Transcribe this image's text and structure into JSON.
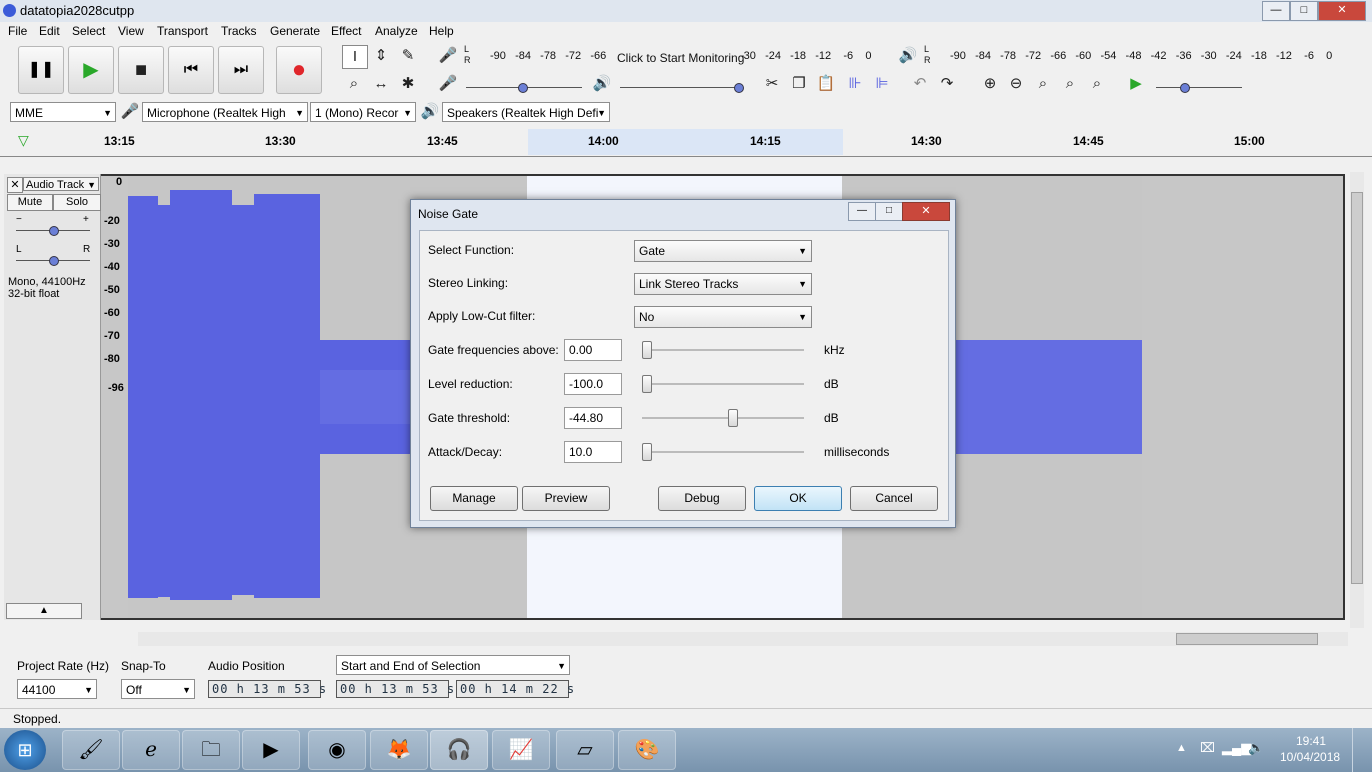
{
  "window": {
    "title": "datatopia2028cutpp",
    "min": "—",
    "max": "□",
    "close": "✕"
  },
  "menu": [
    "File",
    "Edit",
    "Select",
    "View",
    "Transport",
    "Tracks",
    "Generate",
    "Effect",
    "Analyze",
    "Help"
  ],
  "transport": {
    "pause": "❚❚",
    "play": "▶",
    "stop": "■",
    "skip_start": "⏮",
    "skip_end": "⏭",
    "record": "●"
  },
  "meters": {
    "record_scale": [
      "-90",
      "-84",
      "-78",
      "-72",
      "-66"
    ],
    "record_prompt": "Click to Start Monitoring",
    "record_scale_right": [
      "-30",
      "-24",
      "-18",
      "-12",
      "-6",
      "0"
    ],
    "play_scale": [
      "-90",
      "-84",
      "-78",
      "-72",
      "-66",
      "-60",
      "-54",
      "-48",
      "-42",
      "-36",
      "-30",
      "-24",
      "-18",
      "-12",
      "-6",
      "0"
    ],
    "lr": "L\nR"
  },
  "device": {
    "host": "MME",
    "input": "Microphone (Realtek High",
    "channels": "1 (Mono) Recor",
    "output": "Speakers (Realtek High Defi"
  },
  "timeline": {
    "ticks": [
      "13:15",
      "13:30",
      "13:45",
      "14:00",
      "14:15",
      "14:30",
      "14:45",
      "15:00"
    ]
  },
  "track": {
    "name": "Audio Track",
    "mute": "Mute",
    "solo": "Solo",
    "gain_minus": "−",
    "gain_plus": "+",
    "pan_l": "L",
    "pan_r": "R",
    "info1": "Mono, 44100Hz",
    "info2": "32-bit float",
    "db_scale": [
      "0",
      "-20",
      "-30",
      "-40",
      "-50",
      "-60",
      "-70",
      "-80",
      "-96"
    ],
    "gain_level": 0.5,
    "pan_level": 0.5
  },
  "dialog": {
    "title": "Noise Gate",
    "select_function_label": "Select Function:",
    "select_function_value": "Gate",
    "stereo_label": "Stereo Linking:",
    "stereo_value": "Link Stereo Tracks",
    "lowcut_label": "Apply Low-Cut filter:",
    "lowcut_value": "No",
    "freq_label": "Gate frequencies above:",
    "freq_value": "0.00",
    "freq_unit": "kHz",
    "level_label": "Level reduction:",
    "level_value": "-100.0",
    "level_unit": "dB",
    "threshold_label": "Gate threshold:",
    "threshold_value": "-44.80",
    "threshold_unit": "dB",
    "attack_label": "Attack/Decay:",
    "attack_value": "10.0",
    "attack_unit": "milliseconds",
    "btn_manage": "Manage",
    "btn_preview": "Preview",
    "btn_debug": "Debug",
    "btn_ok": "OK",
    "btn_cancel": "Cancel",
    "slider_freq": 0.0,
    "slider_level": 0.0,
    "slider_threshold": 0.56,
    "slider_attack": 0.0
  },
  "bottom": {
    "project_rate_label": "Project Rate (Hz)",
    "project_rate_value": "44100",
    "snap_label": "Snap-To",
    "snap_value": "Off",
    "audio_pos_label": "Audio Position",
    "audio_pos_value": "00 h 13 m 53 s",
    "selection_mode": "Start and End of Selection",
    "sel_start": "00 h 13 m 53 s",
    "sel_end": "00 h 14 m 22 s"
  },
  "status": {
    "text": "Stopped."
  },
  "taskbar": {
    "time": "19:41",
    "date": "10/04/2018"
  },
  "colors": {
    "waveform": "#5a63e0",
    "selection": "#f3f6fd",
    "record": "#e0262b",
    "play": "#2aa82a"
  }
}
